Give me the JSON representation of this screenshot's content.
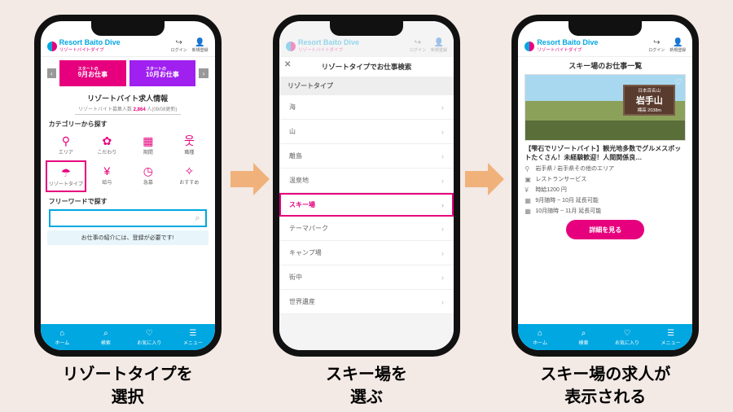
{
  "header": {
    "brand": "Resort Baito Dive",
    "brandSub": "リゾートバイトダイブ",
    "login": "ログイン",
    "signup": "新規登録"
  },
  "phone1": {
    "bannerLeftSmall": "スタートの",
    "bannerLeft": "9月お仕事",
    "bannerRightSmall": "スタートの",
    "bannerRight": "10月お仕事",
    "secTitle": "リゾートバイト求人情報",
    "secSubA": "リゾートバイト募集人数 ",
    "secSubNum": "2,864",
    "secSubB": " 人(09/08更新)",
    "catLabel": "カテゴリーから探す",
    "cats": [
      "エリア",
      "こだわり",
      "期間",
      "職種",
      "リゾートタイプ",
      "給与",
      "急募",
      "おすすめ"
    ],
    "freeLabel": "フリーワードで探す",
    "notice": "お仕事の紹介には、登録が必要です!",
    "tabs": [
      "ホーム",
      "検索",
      "お気に入り",
      "メニュー"
    ]
  },
  "phone2": {
    "modalTitle": "リゾートタイプでお仕事検索",
    "groupLabel": "リゾートタイプ",
    "items": [
      "海",
      "山",
      "離島",
      "温泉地",
      "スキー場",
      "テーマパーク",
      "キャンプ場",
      "街中",
      "世界遺産"
    ]
  },
  "phone3": {
    "pageTitle": "スキー場のお仕事一覧",
    "sign1": "日本百名山",
    "sign2": "岩手山",
    "sign3": "標高 2038m",
    "jobTitle": "【雫石でリゾートバイト】観光地多数でグルメスポットたくさん！未経験歓迎！人間関係良…",
    "meta": [
      "岩手県 / 岩手県その他のエリア",
      "レストランサービス",
      "時給1200 円",
      "9月随時 ~ 10月 延長可能",
      "10月随時 ~ 11月 延長可能"
    ],
    "detailBtn": "詳細を見る"
  },
  "captions": {
    "c1a": "リゾートタイプを",
    "c1b": "選択",
    "c2a": "スキー場を",
    "c2b": "選ぶ",
    "c3a": "スキー場の求人が",
    "c3b": "表示される"
  }
}
